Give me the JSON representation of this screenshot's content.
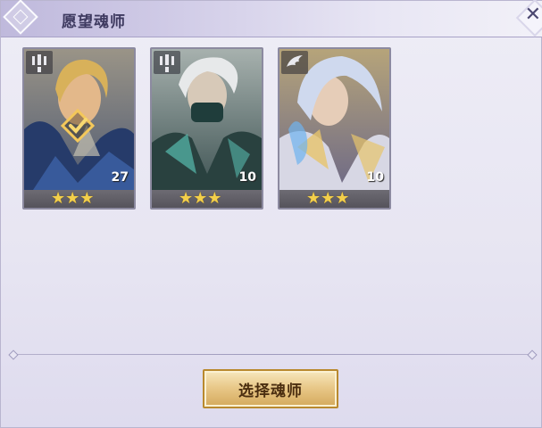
{
  "window": {
    "title": "愿望魂师"
  },
  "close_icon": "close-x-icon",
  "cards": [
    {
      "name": "hero-1",
      "level": "27",
      "stars": "★★★",
      "type_icon": "tower-icon",
      "selected": true,
      "frame_color": "#8a7f66"
    },
    {
      "name": "hero-2",
      "level": "10",
      "stars": "★★★",
      "type_icon": "tower-icon",
      "selected": false,
      "frame_color": "#6f7a77"
    },
    {
      "name": "hero-3",
      "level": "10",
      "stars": "★★★",
      "type_icon": "wing-icon",
      "selected": false,
      "frame_color": "#8e7b52"
    }
  ],
  "footer": {
    "select_label": "选择魂师"
  },
  "colors": {
    "star": "#f3cf4a",
    "button_gold": "#d4a95c",
    "title_text": "#3e3a60"
  }
}
